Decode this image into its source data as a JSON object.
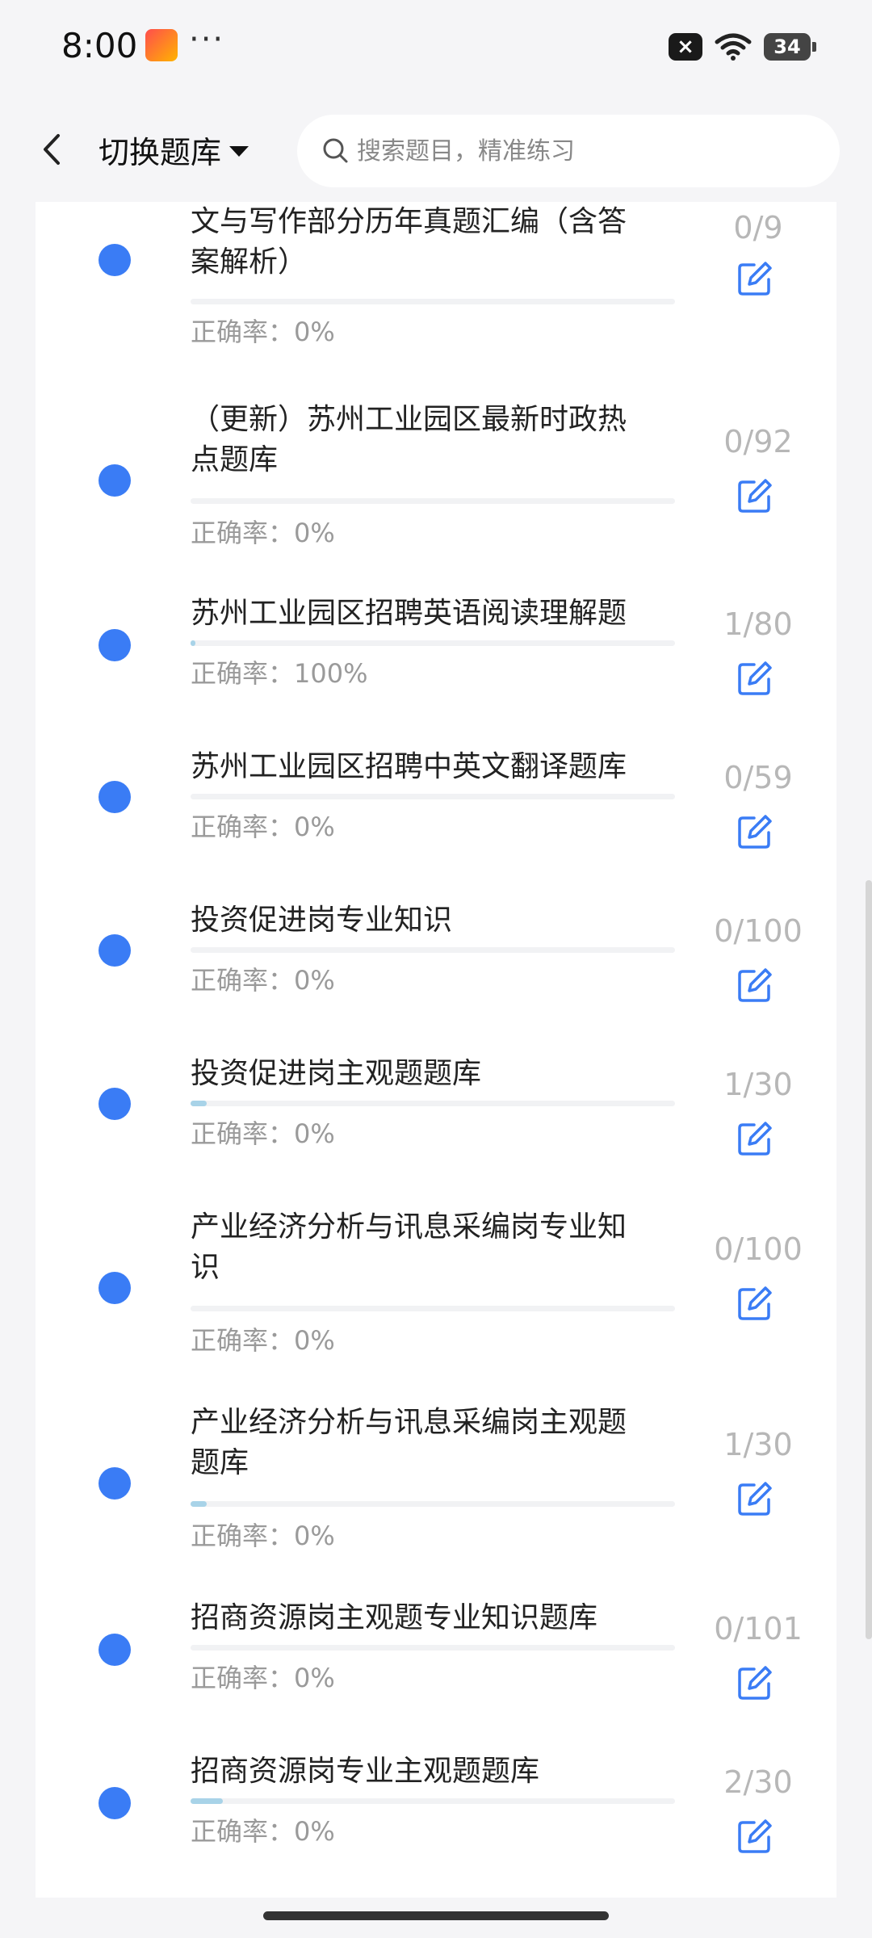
{
  "status_bar": {
    "time": "8:00",
    "dots": "···",
    "battery": "34",
    "icons": [
      "app-icon",
      "close-icon",
      "wifi-icon",
      "battery-icon"
    ]
  },
  "header": {
    "switch_label": "切换题库",
    "search_placeholder": "搜索题目，精准练习",
    "icons": [
      "back-icon",
      "chevron-down-icon",
      "search-icon"
    ]
  },
  "accuracy_prefix": "正确率：",
  "items": [
    {
      "title_lines": [
        "文与写作部分历年真题汇编（含答",
        "案解析）"
      ],
      "count": "0/9",
      "accuracy": "0%",
      "progress": 0
    },
    {
      "title_lines": [
        "（更新）苏州工业园区最新时政热",
        "点题库"
      ],
      "count": "0/92",
      "accuracy": "0%",
      "progress": 0
    },
    {
      "title_lines": [
        "苏州工业园区招聘英语阅读理解题"
      ],
      "count": "1/80",
      "accuracy": "100%",
      "progress": 0.0125
    },
    {
      "title_lines": [
        "苏州工业园区招聘中英文翻译题库"
      ],
      "count": "0/59",
      "accuracy": "0%",
      "progress": 0
    },
    {
      "title_lines": [
        "投资促进岗专业知识"
      ],
      "count": "0/100",
      "accuracy": "0%",
      "progress": 0
    },
    {
      "title_lines": [
        "投资促进岗主观题题库"
      ],
      "count": "1/30",
      "accuracy": "0%",
      "progress": 0.033
    },
    {
      "title_lines": [
        "产业经济分析与讯息采编岗专业知",
        "识"
      ],
      "count": "0/100",
      "accuracy": "0%",
      "progress": 0
    },
    {
      "title_lines": [
        "产业经济分析与讯息采编岗主观题",
        "题库"
      ],
      "count": "1/30",
      "accuracy": "0%",
      "progress": 0.033
    },
    {
      "title_lines": [
        "招商资源岗主观题专业知识题库"
      ],
      "count": "0/101",
      "accuracy": "0%",
      "progress": 0
    },
    {
      "title_lines": [
        "招商资源岗专业主观题题库"
      ],
      "count": "2/30",
      "accuracy": "0%",
      "progress": 0.067
    }
  ],
  "colors": {
    "dot": "#3a7cf5",
    "edit_icon": "#3a7cf5",
    "progress_fill": "#a8d3e8"
  }
}
